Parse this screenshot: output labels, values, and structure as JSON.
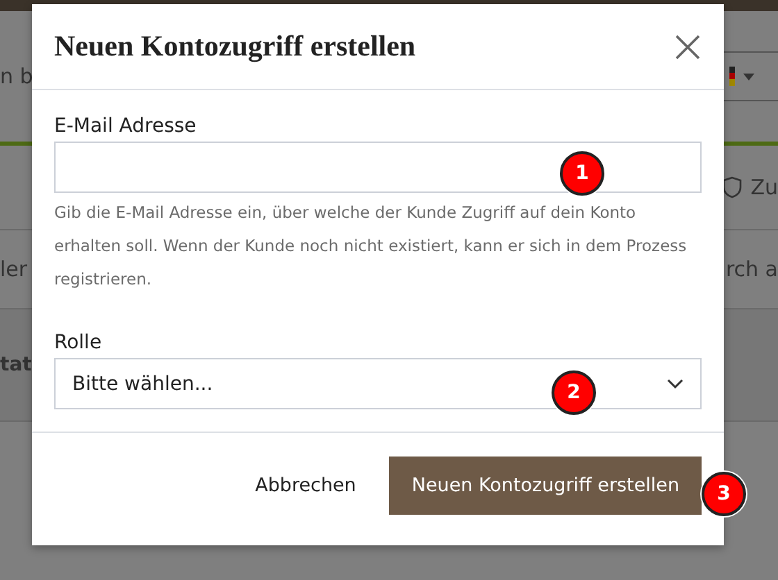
{
  "background_page": {
    "header_search_fragment": "n b",
    "shield_link_fragment": "Zu",
    "left_text_fragment": "ler",
    "right_text_fragment": "rch a",
    "table_heading_fragment": "tat"
  },
  "dialog": {
    "title": "Neuen Kontozugriff erstellen",
    "email_field": {
      "label": "E-Mail Adresse",
      "help": "Gib die E-Mail Adresse ein, über welche der Kunde Zugriff auf dein Konto erhalten soll. Wenn der Kunde noch nicht existiert, kann er sich in dem Prozess registrieren."
    },
    "role_field": {
      "label": "Rolle",
      "value": "Bitte wählen..."
    },
    "buttons": [
      {
        "label": "Abbrechen",
        "kind": "secondary"
      },
      {
        "label": "Neuen Kontozugriff erstellen",
        "kind": "primary"
      }
    ]
  },
  "markers": [
    "1",
    "2",
    "3"
  ]
}
